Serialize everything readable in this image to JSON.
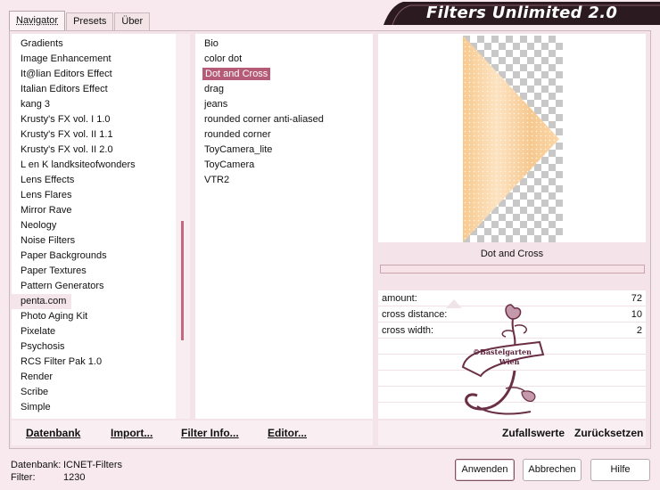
{
  "banner": {
    "title": "Filters Unlimited 2.0"
  },
  "tabs": [
    {
      "label": "Navigator",
      "active": true
    },
    {
      "label": "Presets",
      "active": false
    },
    {
      "label": "Über",
      "active": false
    }
  ],
  "categories": [
    "Gradients",
    "Image Enhancement",
    "It@lian Editors Effect",
    "Italian Editors Effect",
    "kang 3",
    "Krusty's FX vol. I 1.0",
    "Krusty's FX vol. II 1.1",
    "Krusty's FX vol. II 2.0",
    "L en K landksiteofwonders",
    "Lens Effects",
    "Lens Flares",
    "Mirror Rave",
    "Neology",
    "Noise Filters",
    "Paper Backgrounds",
    "Paper Textures",
    "Pattern Generators",
    "penta.com",
    "Photo Aging Kit",
    "Pixelate",
    "Psychosis",
    "RCS Filter Pak 1.0",
    "Render",
    "Scribe",
    "Simple"
  ],
  "highlighted_category": "penta.com",
  "filters": [
    "Bio",
    "color dot",
    "Dot and Cross",
    "drag",
    "jeans",
    "rounded corner anti-aliased",
    "rounded corner",
    "ToyCamera_lite",
    "ToyCamera",
    "VTR2"
  ],
  "selected_filter": "Dot and Cross",
  "preview": {
    "filter_name": "Dot and Cross"
  },
  "params": [
    {
      "label": "amount:",
      "value": "72"
    },
    {
      "label": "cross distance:",
      "value": "10"
    },
    {
      "label": "cross width:",
      "value": "2"
    }
  ],
  "watermark": {
    "line1": "©Bastelgarten",
    "line2": "Wien"
  },
  "links": {
    "database": "Datenbank",
    "import": "Import...",
    "filter_info": "Filter Info...",
    "editor": "Editor...",
    "random": "Zufallswerte",
    "reset": "Zurücksetzen"
  },
  "status": {
    "db_label": "Datenbank:",
    "db_value": "ICNET-Filters",
    "filter_label": "Filter:",
    "filter_value": "1230"
  },
  "buttons": {
    "apply": "Anwenden",
    "cancel": "Abbrechen",
    "help": "Hilfe"
  },
  "colors": {
    "accent": "#b55a77",
    "banner": "#2b1a20",
    "scroll_thumb": "#c4687d"
  }
}
